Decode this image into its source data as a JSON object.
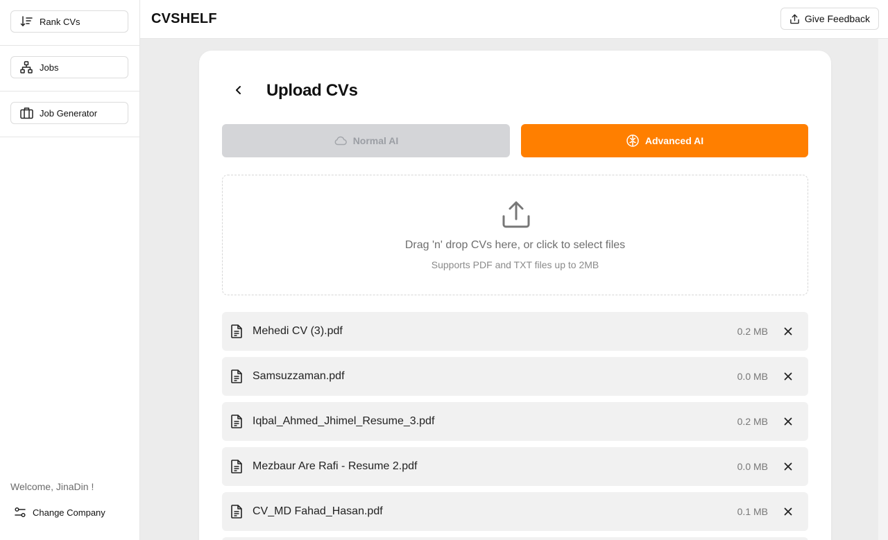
{
  "sidebar": {
    "items": [
      {
        "label": "Rank CVs",
        "icon": "sort-descending-icon"
      },
      {
        "label": "Jobs",
        "icon": "sitemap-icon"
      },
      {
        "label": "Job Generator",
        "icon": "briefcase-icon"
      }
    ],
    "welcome": "Welcome, JinaDin !",
    "change_company": "Change Company"
  },
  "header": {
    "brand": "CVSHELF",
    "feedback_label": "Give Feedback"
  },
  "main": {
    "title": "Upload CVs",
    "modes": {
      "normal_label": "Normal AI",
      "advanced_label": "Advanced AI",
      "selected": "Advanced AI"
    },
    "dropzone": {
      "text": "Drag 'n' drop CVs here, or click to select files",
      "subtext": "Supports PDF and TXT files up to 2MB"
    },
    "files": [
      {
        "name": "Mehedi CV (3).pdf",
        "size": "0.2 MB"
      },
      {
        "name": "Samsuzzaman.pdf",
        "size": "0.0 MB"
      },
      {
        "name": "Iqbal_Ahmed_Jhimel_Resume_3.pdf",
        "size": "0.2 MB"
      },
      {
        "name": "Mezbaur Are Rafi - Resume 2.pdf",
        "size": "0.0 MB"
      },
      {
        "name": "CV_MD Fahad_Hasan.pdf",
        "size": "0.1 MB"
      }
    ]
  },
  "colors": {
    "accent": "#ff7f00",
    "disabled": "#d4d5d8",
    "row_bg": "#f1f1f1"
  }
}
